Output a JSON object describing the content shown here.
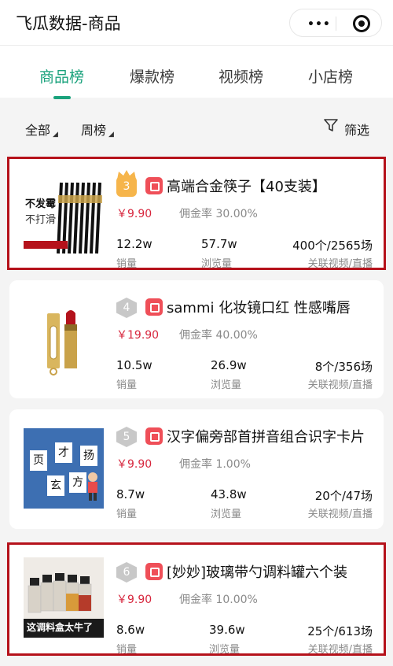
{
  "app": {
    "title": "飞瓜数据-商品"
  },
  "tabs": [
    {
      "label": "商品榜",
      "active": true
    },
    {
      "label": "爆款榜",
      "active": false
    },
    {
      "label": "视频榜",
      "active": false
    },
    {
      "label": "小店榜",
      "active": false
    }
  ],
  "filters": {
    "category": "全部",
    "period": "周榜",
    "filter_label": "筛选"
  },
  "stat_labels": {
    "sales": "销量",
    "views": "浏览量",
    "related": "关联视频/直播"
  },
  "colors": {
    "accent": "#1aa27c",
    "price": "#d7263d",
    "highlight_border": "#b5121b",
    "rank_gold": "#f6b54b",
    "rank_grey": "#c8c8c8"
  },
  "products": [
    {
      "rank": "3",
      "title": "高端合金筷子【40支装】",
      "price": "￥9.90",
      "commission": "佣金率 30.00%",
      "sales": "12.2w",
      "views": "57.7w",
      "related": "400个/2565场",
      "thumb_icon": "chopsticks-image",
      "thumb_text": "不发霉",
      "thumb_text2": "不打滑",
      "highlighted": true
    },
    {
      "rank": "4",
      "title": "sammi 化妆镜口红 性感嘴唇",
      "price": "￥19.90",
      "commission": "佣金率 40.00%",
      "sales": "10.5w",
      "views": "26.9w",
      "related": "8个/356场",
      "thumb_icon": "lipstick-image",
      "highlighted": false
    },
    {
      "rank": "5",
      "title": "汉字偏旁部首拼音组合识字卡片",
      "price": "￥9.90",
      "commission": "佣金率 1.00%",
      "sales": "8.7w",
      "views": "43.8w",
      "related": "20个/47场",
      "thumb_icon": "word-cards-image",
      "thumb_chars": [
        "页",
        "才",
        "玄",
        "方",
        "扬"
      ],
      "highlighted": false
    },
    {
      "rank": "6",
      "title": "[妙妙]玻璃带勺调料罐六个装",
      "price": "￥9.90",
      "commission": "佣金率 10.00%",
      "sales": "8.6w",
      "views": "39.6w",
      "related": "25个/613场",
      "thumb_icon": "spice-jars-image",
      "thumb_text": "这调料盒太牛了",
      "highlighted": true
    }
  ]
}
